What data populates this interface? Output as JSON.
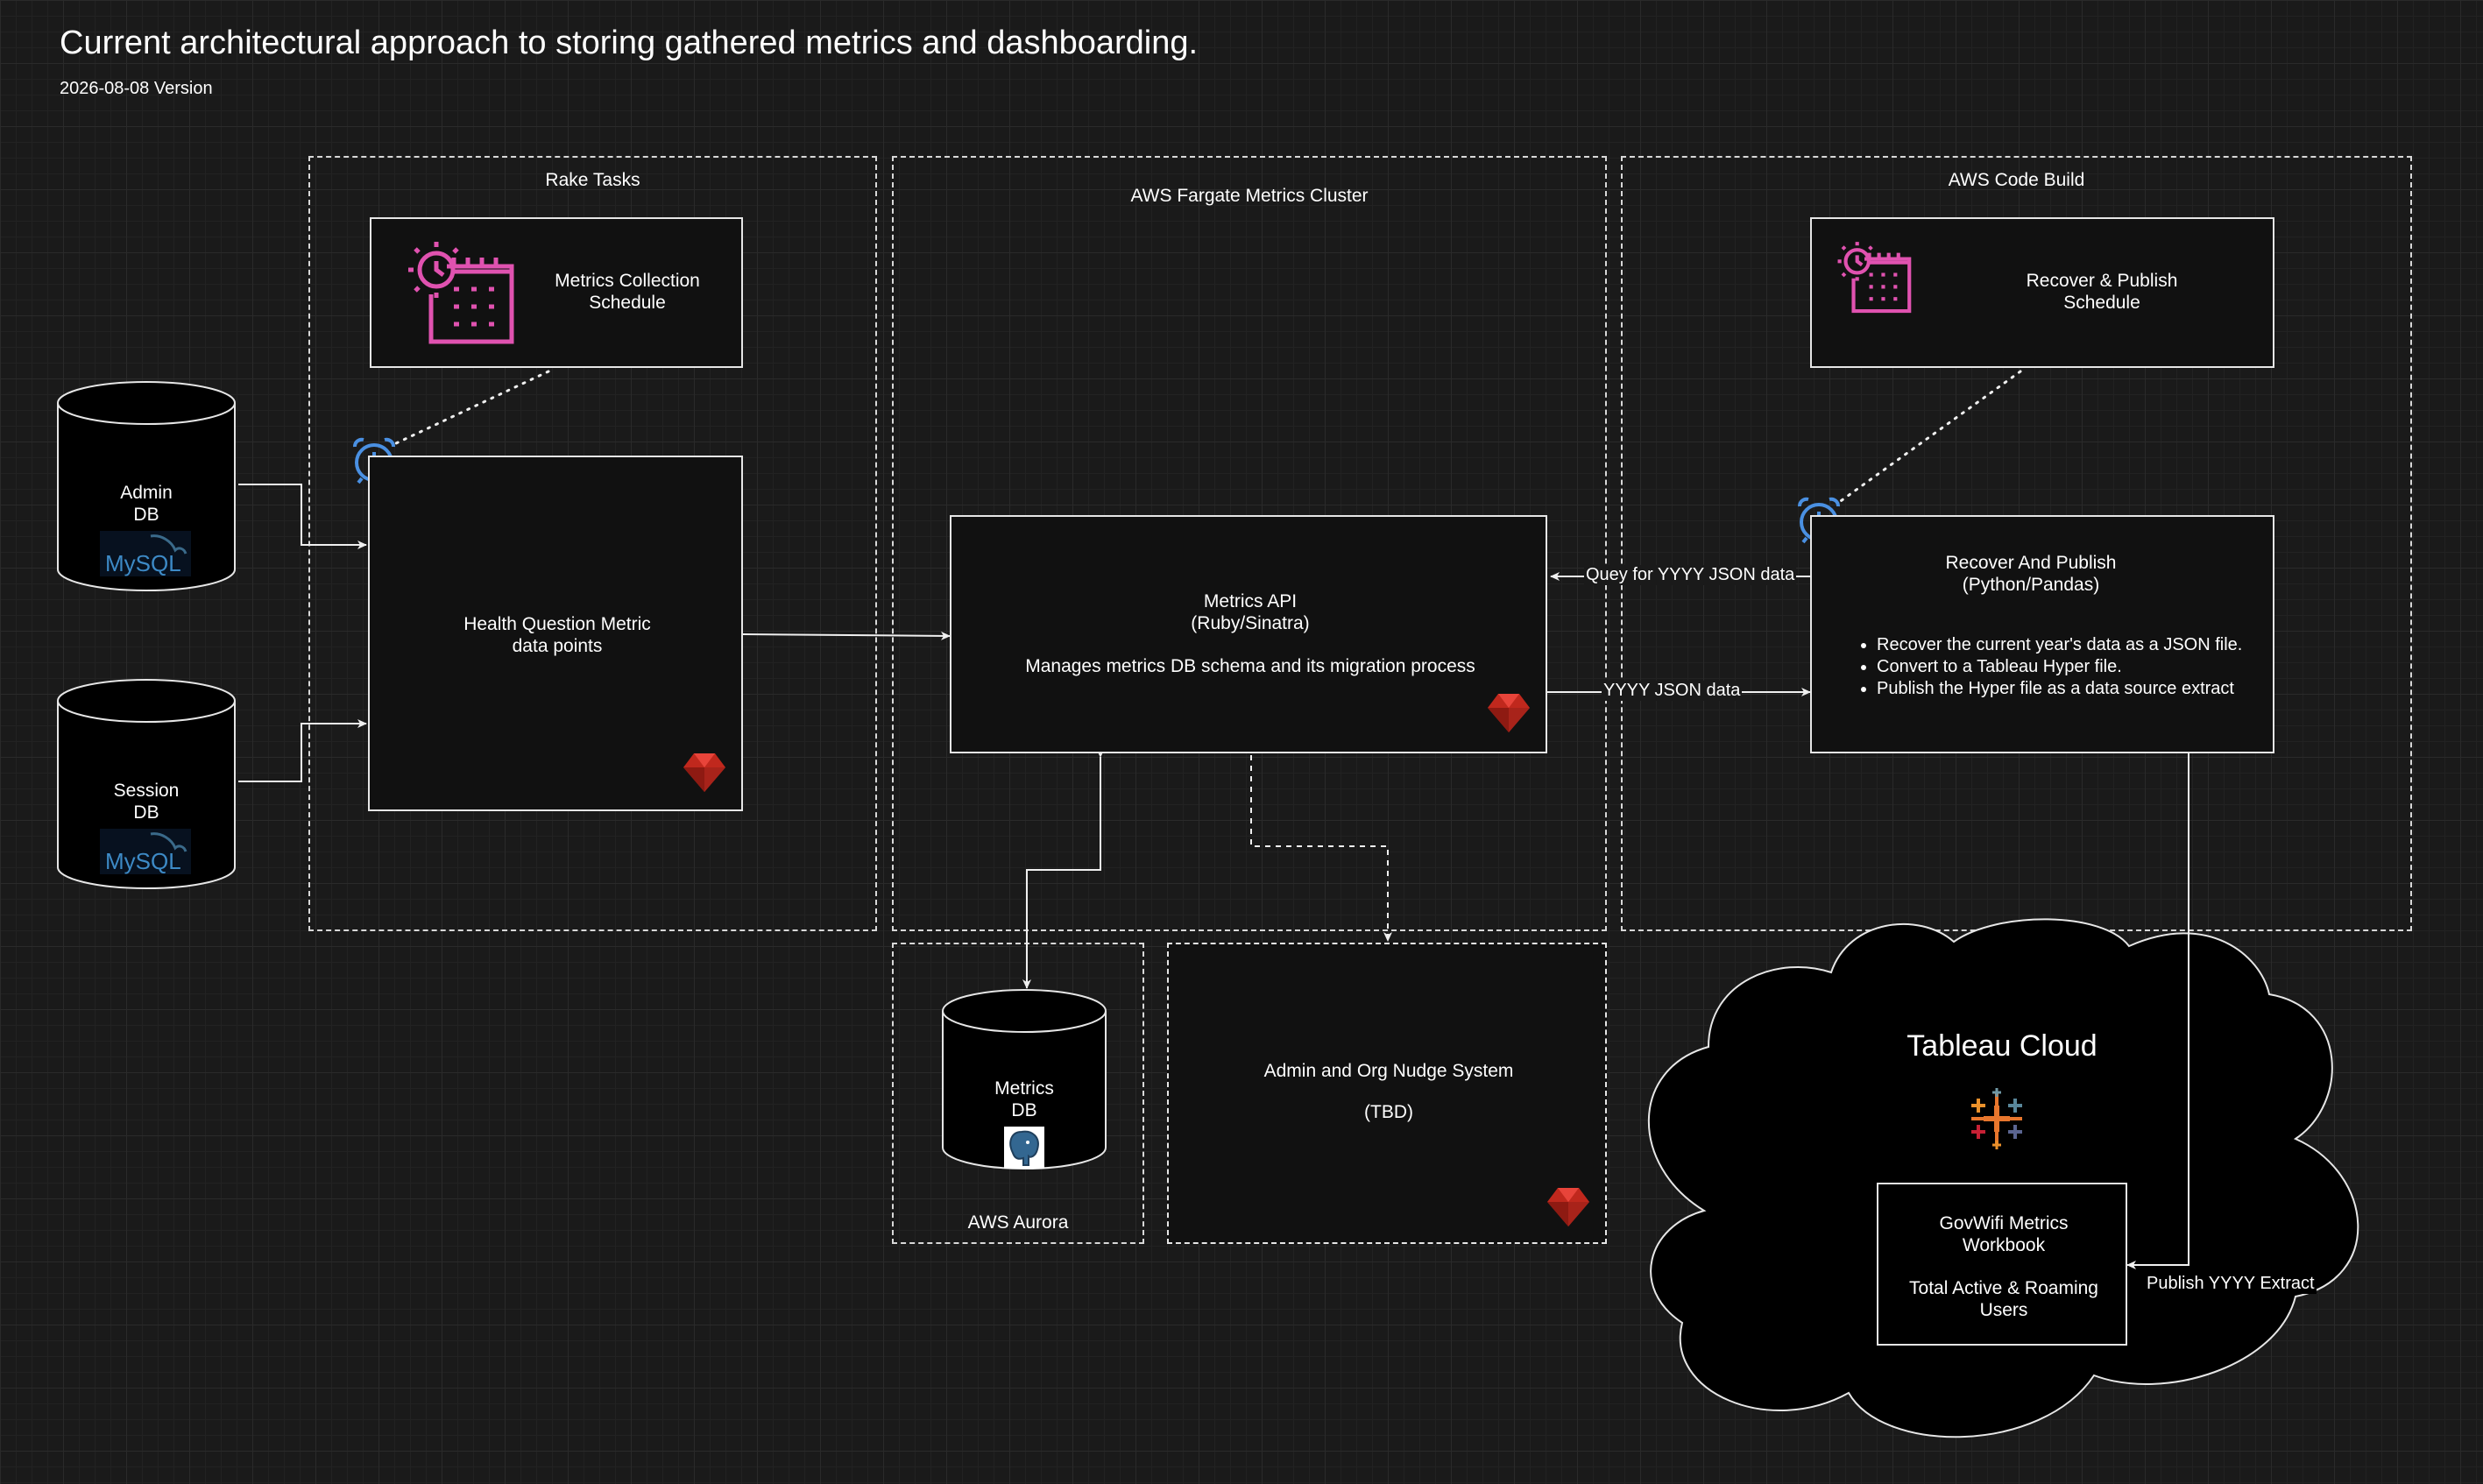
{
  "header": {
    "title": "Current architectural approach to storing gathered metrics and dashboarding.",
    "version": "2026-08-08 Version"
  },
  "zones": {
    "rake": "Rake Tasks",
    "fargate": "AWS Fargate Metrics Cluster",
    "codebuild": "AWS Code Build",
    "aurora": "AWS Aurora"
  },
  "databases": {
    "admin": {
      "line1": "Admin",
      "line2": "DB",
      "logo": "MySQL"
    },
    "session": {
      "line1": "Session",
      "line2": "DB",
      "logo": "MySQL"
    },
    "metrics": {
      "line1": "Metrics",
      "line2": "DB"
    }
  },
  "boxes": {
    "metrics_schedule": {
      "line1": "Metrics Collection",
      "line2": "Schedule"
    },
    "health": {
      "line1": "Health Question Metric",
      "line2": "data points"
    },
    "api": {
      "line1": "Metrics API",
      "line2": "(Ruby/Sinatra)",
      "line3": "Manages metrics DB schema and its migration process"
    },
    "nudge": {
      "line1": "Admin and Org Nudge System",
      "line2": "(TBD)"
    },
    "recover_schedule": {
      "line1": "Recover & Publish",
      "line2": "Schedule"
    },
    "recover": {
      "line1": "Recover And Publish",
      "line2": "(Python/Pandas)",
      "bullets": [
        "Recover the current year's data as a JSON file.",
        "Convert to a Tableau Hyper file.",
        "Publish the Hyper file as a data source extract"
      ]
    },
    "workbook": {
      "line1": "GovWifi Metrics",
      "line2": "Workbook",
      "line3": "Total Active & Roaming",
      "line4": "Users"
    }
  },
  "cloud": {
    "title": "Tableau Cloud"
  },
  "edges": {
    "query": "Quey for YYYY JSON data",
    "json": "YYYY JSON data",
    "publish": "Publish YYYY Extract"
  },
  "colors": {
    "schedule_icon": "#e052b0",
    "alarm_icon": "#4a90e2",
    "ruby": "#c0281d"
  }
}
